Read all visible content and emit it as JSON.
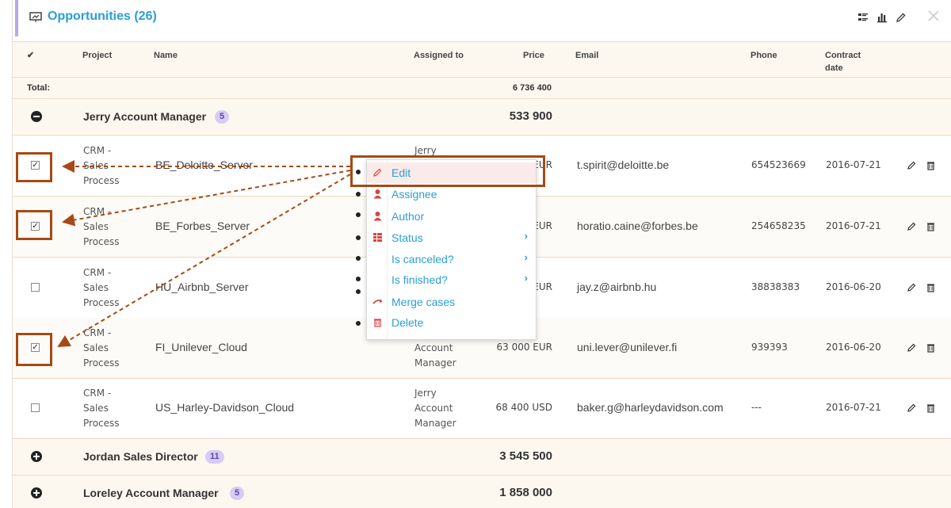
{
  "header": {
    "title": "Opportunities",
    "count": "(26)"
  },
  "columns": {
    "check": "✔",
    "project": "Project",
    "name": "Name",
    "assigned_to": "Assigned to",
    "price": "Price",
    "email": "Email",
    "phone": "Phone",
    "contract_date_1": "Contract",
    "contract_date_2": "date"
  },
  "total": {
    "label": "Total:",
    "value": "6 736 400"
  },
  "groups": [
    {
      "name": "Jerry Account Manager",
      "count": "5",
      "total": "533 900",
      "expanded": true
    },
    {
      "name": "Jordan Sales Director",
      "count": "11",
      "total": "3 545 500",
      "expanded": false
    },
    {
      "name": "Loreley Account Manager",
      "count": "5",
      "total": "1 858 000",
      "expanded": false
    }
  ],
  "rows": [
    {
      "checked": true,
      "project": [
        "CRM -",
        "Sales",
        "Process"
      ],
      "name": "BE_Deloitte_Server",
      "assigned": [
        "Jerry",
        "",
        ""
      ],
      "price": "EUR",
      "email": "t.spirit@deloitte.be",
      "phone": "654523669",
      "date": "2016-07-21"
    },
    {
      "checked": true,
      "project": [
        "CRM -",
        "Sales",
        "Process"
      ],
      "name": "BE_Forbes_Server",
      "assigned": [
        "",
        "",
        ""
      ],
      "price": "EUR",
      "email": "horatio.caine@forbes.be",
      "phone": "254658235",
      "date": "2016-07-21"
    },
    {
      "checked": false,
      "project": [
        "CRM -",
        "Sales",
        "Process"
      ],
      "name": "HU_Airbnb_Server",
      "assigned": [
        "",
        "",
        ""
      ],
      "price": "EUR",
      "email": "jay.z@airbnb.hu",
      "phone": "38838383",
      "date": "2016-06-20"
    },
    {
      "checked": true,
      "project": [
        "CRM -",
        "Sales",
        "Process"
      ],
      "name": "FI_Unilever_Cloud",
      "assigned": [
        "",
        "Account",
        "Manager"
      ],
      "price": "63 000 EUR",
      "email": "uni.lever@unilever.fi",
      "phone": "939393",
      "date": "2016-06-20"
    },
    {
      "checked": false,
      "project": [
        "CRM -",
        "Sales",
        "Process"
      ],
      "name": "US_Harley-Davidson_Cloud",
      "assigned": [
        "Jerry",
        "Account",
        "Manager"
      ],
      "price": "68 400 USD",
      "email": "baker.g@harleydavidson.com",
      "phone": "---",
      "date": "2016-07-21"
    }
  ],
  "context_menu": [
    {
      "label": "Edit",
      "icon": "pencil-icon",
      "submenu": false
    },
    {
      "label": "Assignee",
      "icon": "person-icon",
      "submenu": false
    },
    {
      "label": "Author",
      "icon": "person-icon",
      "submenu": false
    },
    {
      "label": "Status",
      "icon": "status-grid-icon",
      "submenu": true
    },
    {
      "label": "Is canceled?",
      "icon": "",
      "submenu": true
    },
    {
      "label": "Is finished?",
      "icon": "",
      "submenu": true
    },
    {
      "label": "Merge cases",
      "icon": "merge-icon",
      "submenu": false
    },
    {
      "label": "Delete",
      "icon": "trash-icon",
      "submenu": false
    }
  ],
  "colors": {
    "accent_blue": "#2a9fd6",
    "highlight_brown": "#a54a14",
    "badge_purple": "#d7ccf3",
    "icon_red": "#d9443f"
  }
}
